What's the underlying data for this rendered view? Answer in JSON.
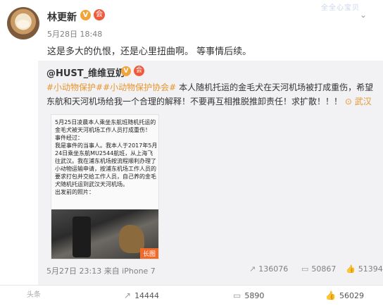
{
  "post": {
    "author": "林更新",
    "v_badge": "V",
    "member_icon": "会",
    "ribbon": "全全心宝贝",
    "chevron": "⌄",
    "time": "5月28日 18:48",
    "text": "这是多大的仇恨，还是心里扭曲啊。 等事情后续。"
  },
  "repost": {
    "author": "@HUST_维维豆奶",
    "v_badge": "V",
    "member_icon": "会",
    "tags": [
      "#小动物保护#",
      "#小动物保护协会#"
    ],
    "body": " 本人随机托运的金毛犬在天河机场被打成重伤，希望东航和天河机场给我一个合理的解释！不要再互相推脱推卸责任！求扩散！！！",
    "location": "武汉",
    "long_image_text": "5月25日凌晨本人乘坐东航班随机托运的金毛犬被天河机场工作人员打成重伤！\n事件经过：\n我是事件的当事人。我本人于2017年5月24日乘坐东航MU2544航班，从上海飞往武汉。我在浦东机场按流程顺利办理了小动物运输申请，按浦东机场工作人员的要求打包并交给工作人员，自己养的金毛犬随机托运到武汉天河机场。\n出发前的照片：",
    "long_badge": "长图",
    "time": "5月27日 23:13 来自 iPhone 7",
    "stats": {
      "forwards": "136076",
      "comments": "50867",
      "likes": "51394"
    }
  },
  "footer": {
    "watermark": "头条",
    "forwards": "14444",
    "comments": "5890",
    "likes": "56029"
  },
  "icons": {
    "forward": "↗",
    "comment": "▭",
    "like": "👍",
    "location": "⊙"
  },
  "colors": {
    "tag_orange": "#e8962e",
    "v_badge": "#f2a33a",
    "long_badge": "#f26a2a",
    "repost_bg": "#f2f2f5"
  }
}
